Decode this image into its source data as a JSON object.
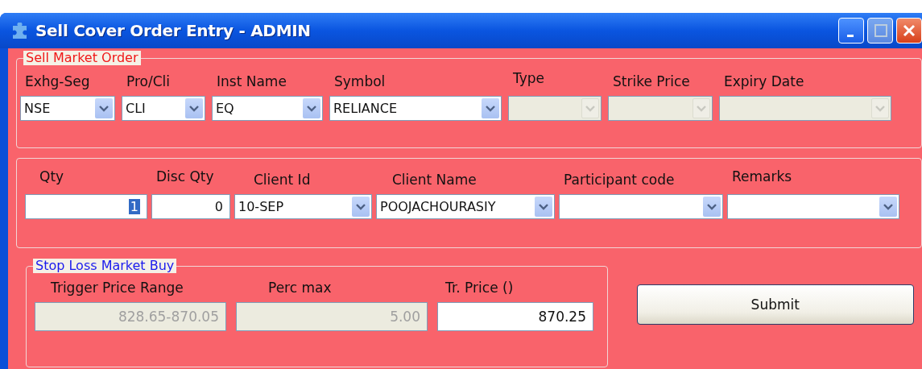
{
  "window": {
    "title": "Sell Cover Order Entry - ADMIN"
  },
  "order_group": {
    "title": "Sell Market Order",
    "fields": [
      {
        "label": "Exhg-Seg",
        "kind": "combo",
        "value": "NSE",
        "disabled": false,
        "value_selected": false
      },
      {
        "label": "Pro/Cli",
        "kind": "combo",
        "value": "CLI",
        "disabled": false,
        "value_selected": false
      },
      {
        "label": "Inst Name",
        "kind": "combo",
        "value": "EQ",
        "disabled": false,
        "value_selected": false
      },
      {
        "label": "Symbol",
        "kind": "combo",
        "value": "RELIANCE",
        "disabled": false,
        "value_selected": false
      },
      {
        "label": "Type",
        "kind": "combo",
        "disabled": true
      },
      {
        "label": "Strike Price",
        "kind": "combo",
        "disabled": true
      },
      {
        "label": "Expiry Date",
        "kind": "combo",
        "disabled": true
      }
    ]
  },
  "client_group": {
    "fields": [
      {
        "label": "Qty",
        "kind": "text",
        "value": "1",
        "disabled": false,
        "value_selected": true
      },
      {
        "label": "Disc Qty",
        "kind": "text",
        "value": "0",
        "disabled": false,
        "value_selected": false
      },
      {
        "label": "Client Id",
        "kind": "combo",
        "value": "10-SEP",
        "disabled": false,
        "value_selected": false
      },
      {
        "label": "Client Name",
        "kind": "combo",
        "value": "POOJACHOURASIY",
        "disabled": false,
        "value_selected": false
      },
      {
        "label": "Participant code",
        "kind": "combo",
        "disabled": false
      },
      {
        "label": "Remarks",
        "kind": "combo",
        "disabled": false
      }
    ]
  },
  "stop_loss_group": {
    "title": "Stop Loss Market Buy",
    "fields": [
      {
        "label": "Trigger Price Range",
        "kind": "text",
        "value": "828.65-870.05",
        "disabled": true,
        "value_selected": false
      },
      {
        "label": "Perc max",
        "kind": "text",
        "value": "5.00",
        "disabled": true,
        "value_selected": false
      },
      {
        "label": "Tr. Price ()",
        "kind": "text",
        "value": "870.25",
        "disabled": false,
        "value_selected": false
      }
    ]
  },
  "buttons": [
    {
      "label": "Submit"
    }
  ]
}
